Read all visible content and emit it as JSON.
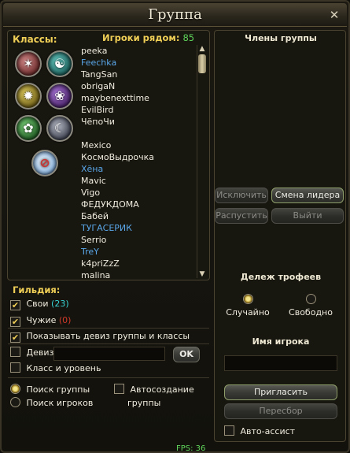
{
  "window": {
    "title": "Группа"
  },
  "left": {
    "classes_label": "Классы:",
    "nearby_label": "Игроки рядом:",
    "nearby_count": "85",
    "players": [
      {
        "name": "peeka",
        "blue": false
      },
      {
        "name": "Feechka",
        "blue": true
      },
      {
        "name": "TangSan",
        "blue": false
      },
      {
        "name": "obrigaN",
        "blue": false
      },
      {
        "name": "maybenexttime",
        "blue": false
      },
      {
        "name": "EvilBird",
        "blue": false
      },
      {
        "name": "ЧёпоЧи",
        "blue": false
      },
      {
        "name": "",
        "blue": false
      },
      {
        "name": "Mexico",
        "blue": false
      },
      {
        "name": "КосмоВыдрочка",
        "blue": false
      },
      {
        "name": "Хёна",
        "blue": true
      },
      {
        "name": "Mavic",
        "blue": false
      },
      {
        "name": "Vigo",
        "blue": false
      },
      {
        "name": "ФЕДУКДОМА",
        "blue": false
      },
      {
        "name": "Бабей",
        "blue": false
      },
      {
        "name": "ТУГАСЕРИК",
        "blue": true
      },
      {
        "name": "Serrio",
        "blue": false
      },
      {
        "name": "TreY",
        "blue": true
      },
      {
        "name": "k4priZzZ",
        "blue": false
      },
      {
        "name": "malina",
        "blue": false
      }
    ]
  },
  "guild": {
    "label": "Гильдия:",
    "own_label": "Свои",
    "own_count": "(23)",
    "foreign_label": "Чужие",
    "foreign_count": "(0)",
    "show_motto_label": "Показывать девиз группы и классы",
    "motto_label": "Девиз",
    "ok_label": "OK",
    "class_level_label": "Класс и уровень",
    "search_group_label": "Поиск группы",
    "search_players_label": "Поиск игроков",
    "auto_create_label_1": "Автосоздание",
    "auto_create_label_2": "группы"
  },
  "right": {
    "members_title": "Члены группы",
    "kick_label": "Исключить",
    "change_leader_label": "Смена лидера",
    "disband_label": "Распустить",
    "leave_label": "Выйти",
    "loot_title": "Дележ трофеев",
    "loot_random": "Случайно",
    "loot_free": "Свободно",
    "player_name_title": "Имя игрока",
    "invite_label": "Пригласить",
    "reselect_label": "Пересбор",
    "auto_assist_label": "Авто-ассист"
  },
  "footer": {
    "fps": "FPS: 36"
  },
  "colors": {
    "accent_gold": "#f0cf57",
    "player_blue": "#5aa6e8",
    "count_green": "#5fd35a",
    "own_cyan": "#38d5d5",
    "foreign_red": "#d03a2a"
  },
  "icons": [
    "class-icon-1",
    "class-icon-2",
    "class-icon-3",
    "class-icon-4",
    "class-icon-5",
    "class-icon-6",
    "class-icon-filter"
  ]
}
